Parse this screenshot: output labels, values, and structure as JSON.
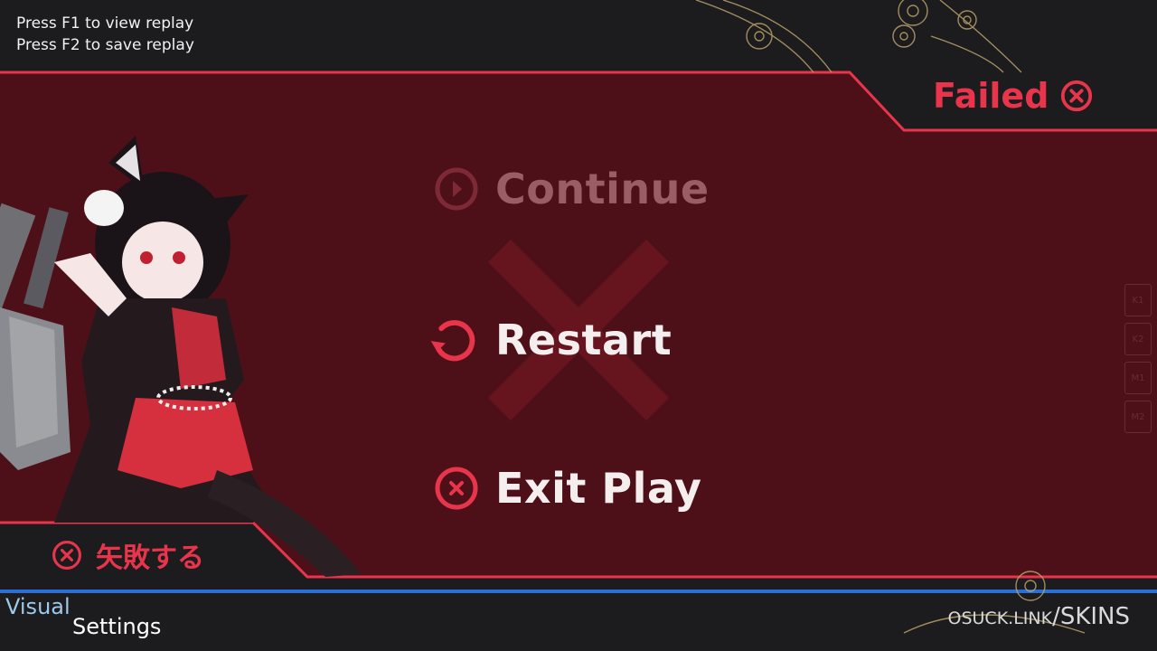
{
  "replay_hints": {
    "view": "Press F1 to view replay",
    "save": "Press F2 to save replay"
  },
  "status": {
    "label": "Failed",
    "jp_label": "矢敗する"
  },
  "menu": {
    "continue": "Continue",
    "restart": "Restart",
    "exit": "Exit Play"
  },
  "key_overlay": [
    "K1",
    "K2",
    "M1",
    "M2"
  ],
  "settings_button": {
    "line1": "Visual",
    "line2": "Settings"
  },
  "watermark": {
    "part1": "OSUCK.LINK",
    "part2": "/SKINS"
  },
  "colors": {
    "accent": "#e8354c",
    "panel": "#4e1018",
    "disabled_text": "#9a5d66",
    "blue_line": "#2a6fd6"
  },
  "icons": {
    "continue": "play-circle-icon",
    "restart": "restart-arrow-icon",
    "exit": "close-circle-icon",
    "failed": "close-circle-icon"
  }
}
